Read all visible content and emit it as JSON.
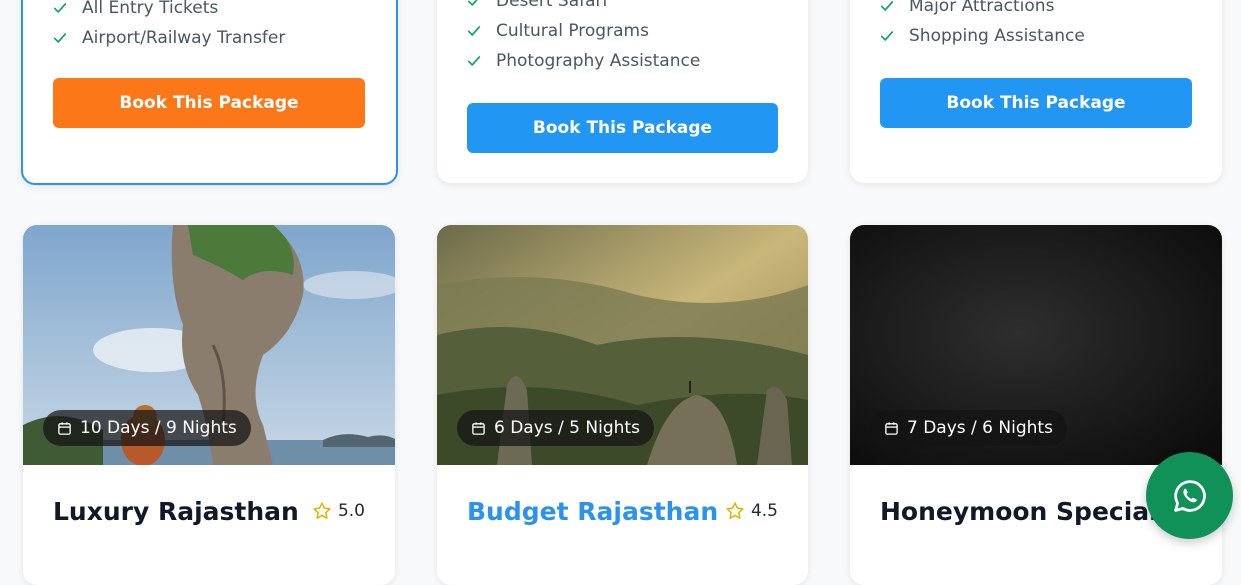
{
  "top_cards": [
    {
      "features": [
        "All Entry Tickets",
        "Airport/Railway Transfer"
      ],
      "button_label": "Book This Package",
      "button_color": "#fb7718",
      "highlighted": true
    },
    {
      "features": [
        "Desert Safari",
        "Cultural Programs",
        "Photography Assistance"
      ],
      "button_label": "Book This Package",
      "button_color": "#2196f3"
    },
    {
      "features": [
        "Major Attractions",
        "Shopping Assistance"
      ],
      "button_label": "Book This Package",
      "button_color": "#2196f3"
    }
  ],
  "packages": [
    {
      "duration": "10 Days / 9 Nights",
      "title": "Luxury Rajasthan",
      "rating": "5.0"
    },
    {
      "duration": "6 Days / 5 Nights",
      "title": "Budget Rajasthan",
      "rating": "4.5",
      "title_color": "#2b93ef"
    },
    {
      "duration": "7 Days / 6 Nights",
      "title": "Honeymoon Special",
      "rating": ""
    }
  ],
  "colors": {
    "accent": "#2196f3",
    "primary_action": "#fb7718",
    "whatsapp": "#109158",
    "check": "#10a36b"
  },
  "icons": [
    "check-icon",
    "calendar-icon",
    "star-icon",
    "whatsapp-icon"
  ]
}
